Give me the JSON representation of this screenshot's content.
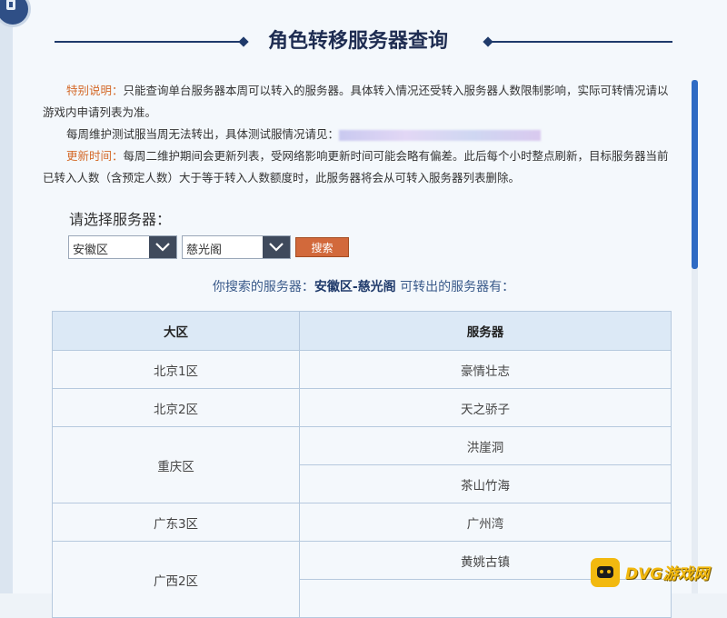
{
  "page": {
    "title": "角色转移服务器查询"
  },
  "notes": {
    "special_label": "特别说明：",
    "special_text": "只能查询单台服务器本周可以转入的服务器。具体转入情况还受转入服务器人数限制影响，实际可转情况请以游戏内申请列表为准。",
    "test_text": "每周维护测试服当周无法转出，具体测试服情况请见：",
    "update_label": "更新时间：",
    "update_text": "每周二维护期间会更新列表，受网络影响更新时间可能会略有偏差。此后每个小时整点刷新，目标服务器当前已转入人数（含预定人数）大于等于转入人数额度时，此服务器将会从可转入服务器列表删除。"
  },
  "query": {
    "label": "请选择服务器：",
    "area_value": "安徽区",
    "server_value": "慈光阁",
    "search_label": "搜索"
  },
  "result": {
    "prefix": "你搜索的服务器：",
    "selected": "安徽区-慈光阁",
    "suffix": " 可转出的服务器有："
  },
  "table": {
    "headers": [
      "大区",
      "服务器"
    ],
    "groups": [
      {
        "area": "北京1区",
        "servers": [
          "豪情壮志"
        ]
      },
      {
        "area": "北京2区",
        "servers": [
          "天之骄子"
        ]
      },
      {
        "area": "重庆区",
        "servers": [
          "洪崖洞",
          "茶山竹海"
        ]
      },
      {
        "area": "广东3区",
        "servers": [
          "广州湾"
        ]
      },
      {
        "area": "广西2区",
        "servers": [
          "黄姚古镇",
          ""
        ]
      }
    ]
  },
  "icons": {
    "dropdown": "chevron-down-icon",
    "corner": "app-badge-icon"
  },
  "watermark": {
    "text": "DVG游戏网"
  },
  "colors": {
    "title": "#1f2d52",
    "highlight": "#d46a2a",
    "button": "#d2693b",
    "scroll": "#2f6bc4",
    "table_header": "#dce9f6"
  }
}
